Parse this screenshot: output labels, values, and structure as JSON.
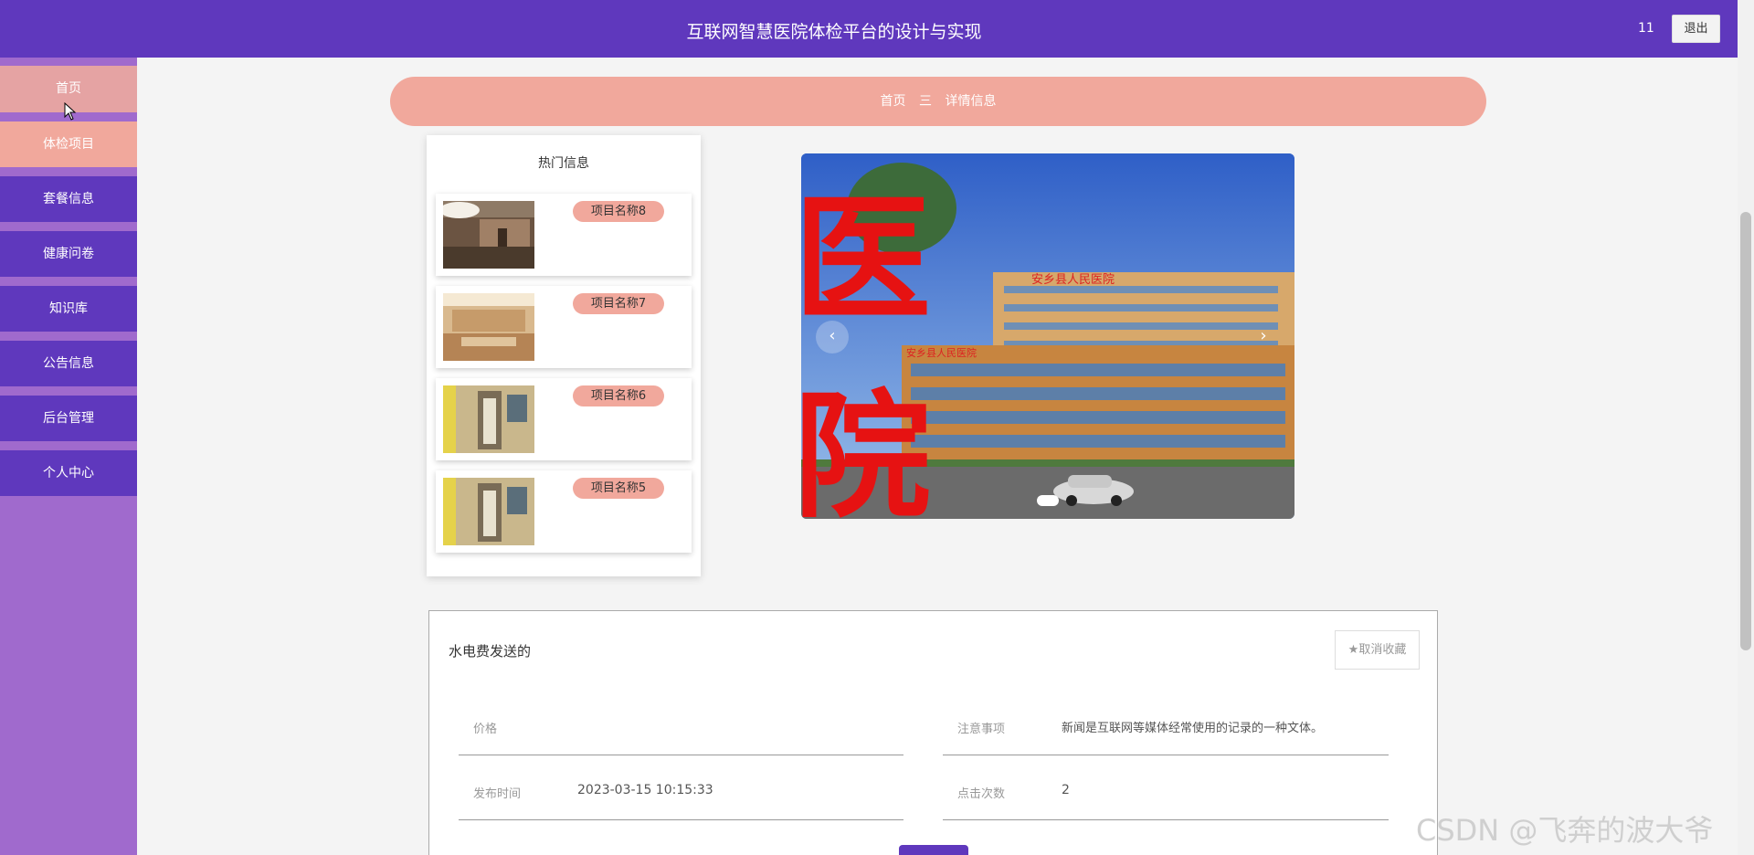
{
  "header": {
    "title": "互联网智慧医院体检平台的设计与实现",
    "user": "11",
    "logout_label": "退出"
  },
  "sidebar": {
    "items": [
      {
        "label": "首页"
      },
      {
        "label": "体检项目"
      },
      {
        "label": "套餐信息"
      },
      {
        "label": "健康问卷"
      },
      {
        "label": "知识库"
      },
      {
        "label": "公告信息"
      },
      {
        "label": "后台管理"
      },
      {
        "label": "个人中心"
      }
    ]
  },
  "breadcrumb": {
    "home": "首页",
    "separator": "三",
    "current": "详情信息"
  },
  "hot": {
    "title": "热门信息",
    "items": [
      {
        "name": "项目名称8"
      },
      {
        "name": "项目名称7"
      },
      {
        "name": "项目名称6"
      },
      {
        "name": "项目名称5"
      }
    ]
  },
  "carousel": {
    "prev": "‹",
    "next": "›",
    "sign_text": "安乡县人民医院",
    "banner_text_top": "医",
    "banner_text_bottom": "院"
  },
  "detail": {
    "title": "水电费发送的",
    "fav_label": "★取消收藏",
    "fields": [
      {
        "label": "价格",
        "value": ""
      },
      {
        "label": "注意事项",
        "value": "新闻是互联网等媒体经常使用的记录的一种文体。"
      },
      {
        "label": "发布时间",
        "value": "2023-03-15 10:15:33"
      },
      {
        "label": "点击次数",
        "value": "2"
      }
    ]
  },
  "watermark": "CSDN @飞奔的波大爷",
  "colors": {
    "primary": "#5f38bd",
    "accent": "#f1a89c",
    "sidebar_bg": "#a06acd"
  }
}
